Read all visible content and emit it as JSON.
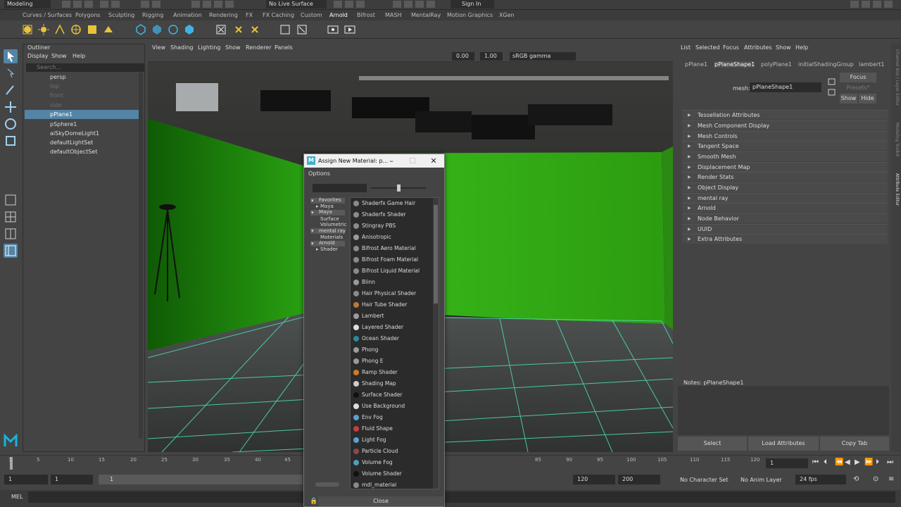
{
  "topbar": {
    "workspace": "Modeling",
    "live_surface": "No Live Surface",
    "sign_in": "Sign In"
  },
  "shelf_tabs": [
    "Curves / Surfaces",
    "Polygons",
    "Sculpting",
    "Rigging",
    "Animation",
    "Rendering",
    "FX",
    "FX Caching",
    "Custom",
    "Arnold",
    "Bifrost",
    "MASH",
    "MentalRay",
    "Motion Graphics",
    "XGen"
  ],
  "outliner": {
    "title": "Outliner",
    "menu": [
      "Display",
      "Show",
      "Help"
    ],
    "search_placeholder": "Search...",
    "items": [
      {
        "label": "persp",
        "state": "normal"
      },
      {
        "label": "top",
        "state": "dim"
      },
      {
        "label": "front",
        "state": "dim"
      },
      {
        "label": "side",
        "state": "dim"
      },
      {
        "label": "pPlane1",
        "state": "selected"
      },
      {
        "label": "pSphere1",
        "state": "normal"
      },
      {
        "label": "aiSkyDomeLight1",
        "state": "normal"
      },
      {
        "label": "defaultLightSet",
        "state": "normal"
      },
      {
        "label": "defaultObjectSet",
        "state": "normal"
      }
    ]
  },
  "viewport": {
    "menu": [
      "View",
      "Shading",
      "Lighting",
      "Show",
      "Renderer",
      "Panels"
    ],
    "exposure": "0.00",
    "gamma": "1.00",
    "colorspace": "sRGB gamma"
  },
  "attribute_editor": {
    "menu": [
      "List",
      "Selected",
      "Focus",
      "Attributes",
      "Show",
      "Help"
    ],
    "tabs": [
      "pPlane1",
      "pPlaneShape1",
      "polyPlane1",
      "initialShadingGroup",
      "lambert1"
    ],
    "active_tab": "pPlaneShape1",
    "mesh_label": "mesh:",
    "mesh_value": "pPlaneShape1",
    "focus_button": "Focus",
    "presets_button": "Presets*",
    "show_button": "Show",
    "hide_button": "Hide",
    "sections": [
      "Tessellation Attributes",
      "Mesh Component Display",
      "Mesh Controls",
      "Tangent Space",
      "Smooth Mesh",
      "Displacement Map",
      "Render Stats",
      "Object Display",
      "mental ray",
      "Arnold",
      "Node Behavior",
      "UUID",
      "Extra Attributes"
    ],
    "notes_label": "Notes:  pPlaneShape1",
    "bottom_buttons": [
      "Select",
      "Load Attributes",
      "Copy Tab"
    ],
    "side_labels": [
      "Channel Box / Layer Editor",
      "Modeling Toolkit",
      "Attribute Editor"
    ]
  },
  "timeline": {
    "ticks": [
      "1",
      "5",
      "10",
      "15",
      "20",
      "25",
      "30",
      "35",
      "40",
      "45",
      "85",
      "90",
      "95",
      "100",
      "105",
      "110",
      "115",
      "120"
    ],
    "current_frame": "1"
  },
  "range": {
    "start": "1",
    "start2": "1",
    "range_label": "1",
    "end": "120",
    "end2": "200",
    "character_set": "No Character Set",
    "anim_layer": "No Anim Layer",
    "fps": "24 fps"
  },
  "cmdline": {
    "label": "MEL"
  },
  "dialog": {
    "title": "Assign New Material: p...",
    "options_label": "Options",
    "tree": [
      "Favorites",
      "Maya",
      "Maya",
      "Surface",
      "Volumetric",
      "mental ray",
      "Materials",
      "Arnold",
      "Shader"
    ],
    "materials": [
      {
        "label": "Shaderfx Game Hair",
        "color": "#8a8a8a"
      },
      {
        "label": "Shaderfx Shader",
        "color": "#8a8a8a"
      },
      {
        "label": "Stingray PBS",
        "color": "#8a8a8a"
      },
      {
        "label": "Anisotropic",
        "color": "#9a9a9a"
      },
      {
        "label": "Bifrost Aero Material",
        "color": "#8a8a8a"
      },
      {
        "label": "Bifrost Foam Material",
        "color": "#8a8a8a"
      },
      {
        "label": "Bifrost Liquid Material",
        "color": "#8a8a8a"
      },
      {
        "label": "Blinn",
        "color": "#9a9a9a"
      },
      {
        "label": "Hair Physical Shader",
        "color": "#8a8a8a"
      },
      {
        "label": "Hair Tube Shader",
        "color": "#b87a3a"
      },
      {
        "label": "Lambert",
        "color": "#9a9a9a"
      },
      {
        "label": "Layered Shader",
        "color": "#dddddd"
      },
      {
        "label": "Ocean Shader",
        "color": "#2a8a9a"
      },
      {
        "label": "Phong",
        "color": "#9a9a9a"
      },
      {
        "label": "Phong E",
        "color": "#9a9a9a"
      },
      {
        "label": "Ramp Shader",
        "color": "#d07a2a"
      },
      {
        "label": "Shading Map",
        "color": "#cccccc"
      },
      {
        "label": "Surface Shader",
        "color": "#111111"
      },
      {
        "label": "Use Background",
        "color": "#dddddd"
      },
      {
        "label": "Env Fog",
        "color": "#5aa0d0"
      },
      {
        "label": "Fluid Shape",
        "color": "#c04040"
      },
      {
        "label": "Light Fog",
        "color": "#5aa0d0"
      },
      {
        "label": "Particle Cloud",
        "color": "#8a4a4a"
      },
      {
        "label": "Volume Fog",
        "color": "#4aa0c0"
      },
      {
        "label": "Volume Shader",
        "color": "#111111"
      },
      {
        "label": "mdl_material",
        "color": "#8a8a8a"
      }
    ],
    "close_button": "Close"
  }
}
